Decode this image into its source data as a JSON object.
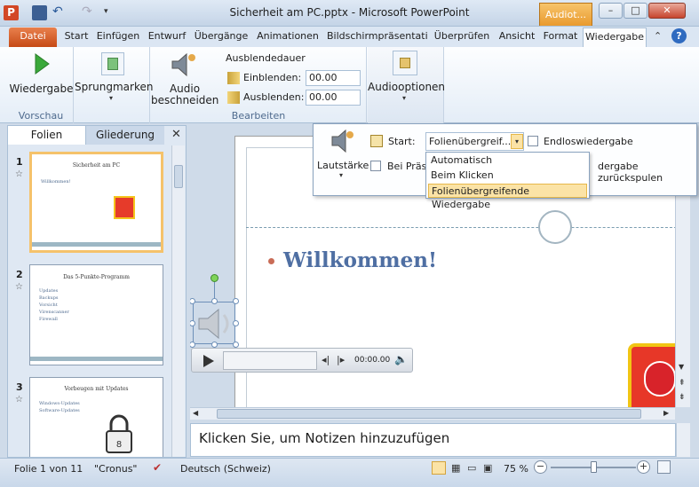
{
  "window": {
    "title": "Sicherheit am PC.pptx - Microsoft PowerPoint",
    "context_tab": "Audiot...",
    "app_badge": "P"
  },
  "tabs": [
    "Datei",
    "Start",
    "Einfügen",
    "Entwurf",
    "Übergänge",
    "Animationen",
    "Bildschirmpräsentatic",
    "Überprüfen",
    "Ansicht",
    "Format",
    "Wiedergabe"
  ],
  "ribbon": {
    "vorschau": {
      "button": "Wiedergabe",
      "group": "Vorschau"
    },
    "sprungmarken": {
      "button": "Sprungmarken"
    },
    "bearbeiten": {
      "trim_line1": "Audio",
      "trim_line2": "beschneiden",
      "fade_title": "Ausblendedauer",
      "fade_in_label": "Einblenden:",
      "fade_in_value": "00.00",
      "fade_out_label": "Ausblenden:",
      "fade_out_value": "00.00",
      "group": "Bearbeiten"
    },
    "audiooptionen": {
      "button": "Audiooptionen"
    }
  },
  "popup": {
    "volume": "Lautstärke",
    "start_label": "Start:",
    "start_value": "Folienübergreif...",
    "loop": "Endloswiedergabe",
    "hide_partial": "Bei Präse",
    "rewind_partial": "dergabe zurückspulen",
    "options": [
      "Automatisch",
      "Beim Klicken",
      "Folienübergreifende Wiedergabe"
    ]
  },
  "panes": {
    "slides_tab": "Folien",
    "outline_tab": "Gliederung"
  },
  "thumbnails": [
    {
      "num": "1",
      "title": "Sicherheit am PC",
      "bullets": [
        "Willkommen!"
      ]
    },
    {
      "num": "2",
      "title": "Das 5-Punkte-Programm",
      "bullets": [
        "Updates",
        "Backups",
        "Vorsicht",
        "Virenscanner",
        "Firewall"
      ]
    },
    {
      "num": "3",
      "title": "Vorbeugen mit Updates",
      "bullets": [
        "Windows-Updates",
        "Software-Updates"
      ]
    }
  ],
  "slide": {
    "heading": "Willkommen!"
  },
  "player": {
    "time": "00:00.00"
  },
  "notes": {
    "placeholder": "Klicken Sie, um Notizen hinzuzufügen"
  },
  "status": {
    "slide": "Folie 1 von 11",
    "theme": "\"Cronus\"",
    "language": "Deutsch (Schweiz)",
    "zoom": "75 %",
    "zoom_level": 0.5
  }
}
